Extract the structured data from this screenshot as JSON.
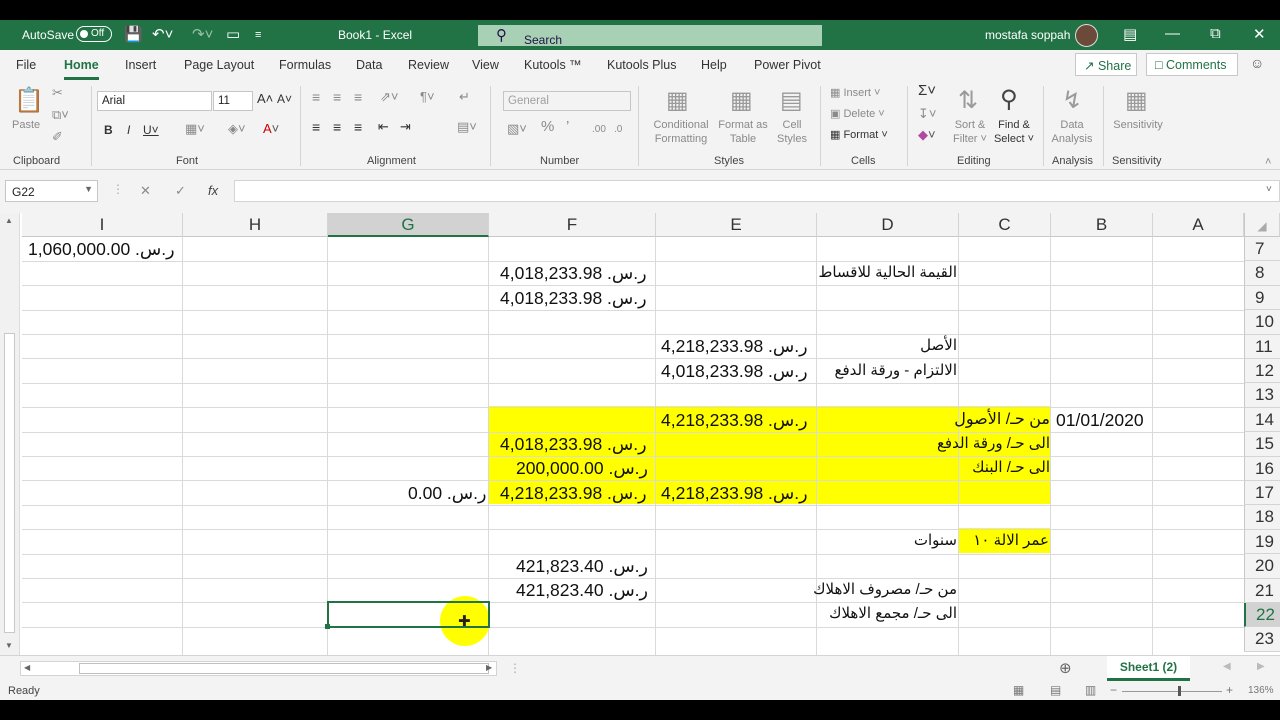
{
  "title_bar": {
    "autosave_label": "AutoSave",
    "autosave_state": "Off",
    "doc_title": "Book1  -  Excel",
    "search_placeholder": "Search",
    "user_name": "mostafa soppah"
  },
  "menu": {
    "tabs": [
      "File",
      "Home",
      "Insert",
      "Page Layout",
      "Formulas",
      "Data",
      "Review",
      "View",
      "Kutools ™",
      "Kutools Plus",
      "Help",
      "Power Pivot"
    ],
    "active_tab": "Home",
    "share_label": "Share",
    "comments_label": "Comments"
  },
  "ribbon": {
    "clipboard": {
      "paste": "Paste",
      "group": "Clipboard"
    },
    "font": {
      "name": "Arial",
      "size": "11",
      "group": "Font"
    },
    "alignment": {
      "group": "Alignment"
    },
    "number": {
      "format": "General",
      "group": "Number"
    },
    "styles": {
      "conditional": "Conditional",
      "conditional2": "Formatting",
      "format_as": "Format as",
      "format_as2": "Table",
      "cell": "Cell",
      "cell2": "Styles",
      "group": "Styles"
    },
    "cells": {
      "insert": "Insert",
      "delete": "Delete",
      "format": "Format",
      "group": "Cells"
    },
    "editing": {
      "sort": "Sort &",
      "sort2": "Filter",
      "find": "Find &",
      "find2": "Select",
      "group": "Editing"
    },
    "analysis": {
      "data": "Data",
      "data2": "Analysis",
      "group": "Analysis"
    },
    "sensitivity": {
      "label": "Sensitivity",
      "group": "Sensitivity"
    }
  },
  "formula_bar": {
    "name_box": "G22",
    "fx": "fx",
    "formula": ""
  },
  "sheet": {
    "columns": [
      "I",
      "H",
      "G",
      "F",
      "E",
      "D",
      "C",
      "B",
      "A"
    ],
    "selected_column": "G",
    "rows": [
      "7",
      "8",
      "9",
      "10",
      "11",
      "12",
      "13",
      "14",
      "15",
      "16",
      "17",
      "18",
      "19",
      "20",
      "21",
      "22",
      "23"
    ],
    "selected_row": "22",
    "selected_cell": "G22",
    "cells": {
      "I7": "ر.س.  1,060,000.00",
      "D8": "القيمة الحالية للاقساط",
      "F8": "ر.س.  4,018,233.98",
      "F9": "ر.س.  4,018,233.98",
      "D11": "الأصل",
      "E11": "ر.س.  4,218,233.98",
      "D12": "الالتزام - ورقة الدفع",
      "E12": "ر.س.  4,018,233.98",
      "B14": "01/01/2020",
      "D14": "من حـ/ الأصول",
      "E14": "ر.س.  4,218,233.98",
      "D15": "الى حـ/ ورقة الدفع",
      "F15": "ر.س.  4,018,233.98",
      "D16": "الى حـ/ البنك",
      "F16": "ر.س.  200,000.00",
      "E17": "ر.س.  4,218,233.98",
      "F17": "ر.س.  4,218,233.98",
      "G17": "ر.س.  0.00",
      "C19": "عمر الالة ١٠",
      "D19": "سنوات",
      "F20": "ر.س.  421,823.40",
      "D21": "من حـ/ مصروف الاهلاك",
      "F21": "ر.س.  421,823.40",
      "D22": "الى حـ/ مجمع الاهلاك"
    }
  },
  "sheet_tab": {
    "label": "Sheet1 (2)"
  },
  "status_bar": {
    "ready": "Ready",
    "zoom": "136%"
  },
  "colors": {
    "excel_green": "#217346",
    "highlight": "#ffff00"
  }
}
